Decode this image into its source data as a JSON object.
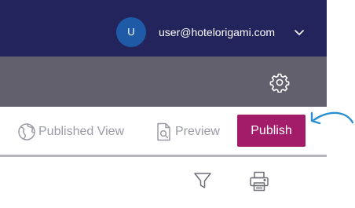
{
  "header": {
    "avatar_initial": "U",
    "user_email": "user@hotelorigami.com",
    "icons": {
      "menu": "chevron-down-icon"
    },
    "colors": {
      "background": "#23245b",
      "avatar": "#1f5aa6"
    }
  },
  "toolbar": {
    "icons": {
      "settings": "gear-icon"
    },
    "colors": {
      "background": "#63606e"
    }
  },
  "actions": {
    "published_view_label": "Published View",
    "preview_label": "Preview",
    "publish_label": "Publish",
    "icons": {
      "published_view": "globe-icon",
      "preview": "document-search-icon",
      "callout": "curved-arrow-icon"
    },
    "colors": {
      "publish": "#a31c69",
      "callout": "#2a8fd0",
      "muted_text": "#9a9ba6"
    }
  },
  "tools": {
    "icons": {
      "filter": "filter-icon",
      "print": "printer-icon"
    }
  }
}
